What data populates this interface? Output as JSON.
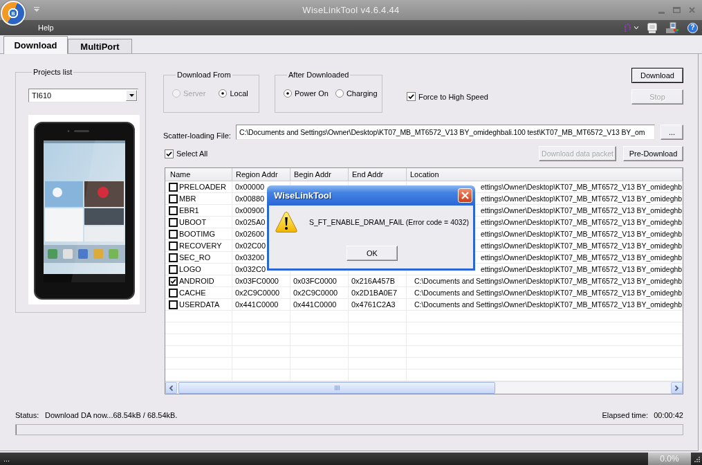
{
  "window": {
    "logo_letter": "B",
    "title": "WiseLinkTool v4.6.4.44"
  },
  "menu_bar": {
    "items": [
      "Help"
    ],
    "help_glyph": "?"
  },
  "tabs": [
    {
      "label": "Download",
      "selected": true
    },
    {
      "label": "MultiPort",
      "selected": false
    }
  ],
  "projects_list": {
    "title": "Projects list",
    "value": "TI610"
  },
  "download_from": {
    "title": "Download From",
    "options": [
      {
        "label": "Server",
        "selected": false,
        "disabled": true
      },
      {
        "label": "Local",
        "selected": true,
        "disabled": false
      }
    ]
  },
  "after_downloaded": {
    "title": "After Downloaded",
    "options": [
      {
        "label": "Power On",
        "selected": true
      },
      {
        "label": "Charging",
        "selected": false
      }
    ]
  },
  "force_high_speed": {
    "label": "Force to High Speed",
    "checked": true
  },
  "actions": [
    {
      "label": "Download",
      "disabled": false,
      "default": true
    },
    {
      "label": "Stop",
      "disabled": true,
      "default": false
    }
  ],
  "scatter_file": {
    "label": "Scatter-loading File:",
    "value": "C:\\Documents and Settings\\Owner\\Desktop\\KT07_MB_MT6572_V13 BY_omideghbali.100 test\\KT07_MB_MT6572_V13 BY_om",
    "browse": "..."
  },
  "select_all": {
    "label": "Select All",
    "checked": true
  },
  "packet_actions": [
    {
      "label": "Download data packet",
      "disabled": true
    },
    {
      "label": "Pre-Download",
      "disabled": false
    }
  ],
  "table": {
    "columns": [
      "Name",
      "Region Addr",
      "Begin Addr",
      "End Addr",
      "Location"
    ],
    "rows": [
      {
        "name": "PRELOADER",
        "checked": false,
        "region": "0x00000",
        "location": "ettings\\Owner\\Desktop\\KT07_MB_MT6572_V13 BY_omideghb"
      },
      {
        "name": "MBR",
        "checked": false,
        "region": "0x00880",
        "location": "ettings\\Owner\\Desktop\\KT07_MB_MT6572_V13 BY_omideghb"
      },
      {
        "name": "EBR1",
        "checked": false,
        "region": "0x00900",
        "location": "ettings\\Owner\\Desktop\\KT07_MB_MT6572_V13 BY_omideghb"
      },
      {
        "name": "UBOOT",
        "checked": false,
        "region": "0x025A0",
        "location": "ettings\\Owner\\Desktop\\KT07_MB_MT6572_V13 BY_omideghb"
      },
      {
        "name": "BOOTIMG",
        "checked": false,
        "region": "0x02600",
        "location": "ettings\\Owner\\Desktop\\KT07_MB_MT6572_V13 BY_omideghb"
      },
      {
        "name": "RECOVERY",
        "checked": false,
        "region": "0x02C00",
        "location": "ettings\\Owner\\Desktop\\KT07_MB_MT6572_V13 BY_omideghb"
      },
      {
        "name": "SEC_RO",
        "checked": false,
        "region": "0x03200",
        "location": "ettings\\Owner\\Desktop\\KT07_MB_MT6572_V13 BY_omideghb"
      },
      {
        "name": "LOGO",
        "checked": false,
        "region": "0x032C0",
        "location": "ettings\\Owner\\Desktop\\KT07_MB_MT6572_V13 BY_omideghb"
      },
      {
        "name": "ANDROID",
        "checked": true,
        "region": "0x03FC0000",
        "begin": "0x03FC0000",
        "end": "0x216A457B",
        "location": "C:\\Documents and Settings\\Owner\\Desktop\\KT07_MB_MT6572_V13 BY_omideghb"
      },
      {
        "name": "CACHE",
        "checked": false,
        "region": "0x2C9C0000",
        "begin": "0x2C9C0000",
        "end": "0x2D1BA0E7",
        "location": "C:\\Documents and Settings\\Owner\\Desktop\\KT07_MB_MT6572_V13 BY_omideghb"
      },
      {
        "name": "USERDATA",
        "checked": false,
        "region": "0x441C0000",
        "begin": "0x441C0000",
        "end": "0x4761C2A3",
        "location": "C:\\Documents and Settings\\Owner\\Desktop\\KT07_MB_MT6572_V13 BY_omideghb"
      }
    ]
  },
  "status": {
    "label": "Status:",
    "text": "Download DA now...68.54kB / 68.54kB.",
    "elapsed_label": "Elapsed time:",
    "elapsed": "00:00:42",
    "level": 0
  },
  "bottom_bar": {
    "left": "...",
    "percent": "0.0%"
  },
  "dialog": {
    "title": "WiseLinkTool",
    "message": "S_FT_ENABLE_DRAM_FAIL (Error code = 4032)",
    "button": "OK"
  }
}
